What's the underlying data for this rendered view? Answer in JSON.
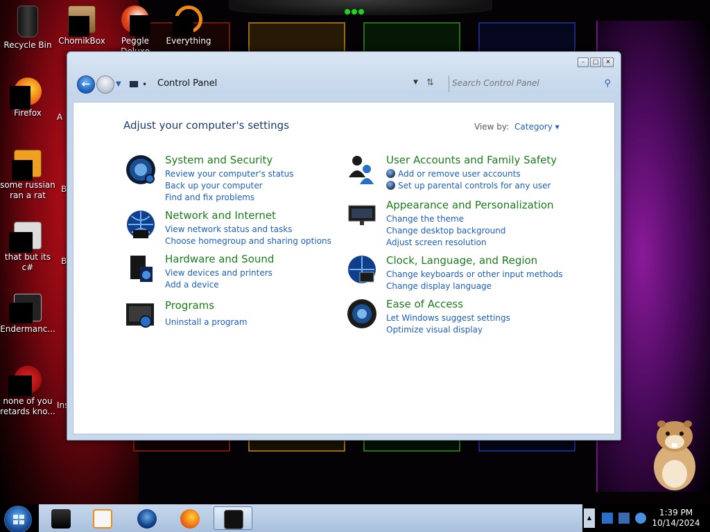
{
  "desktop": {
    "icons": [
      {
        "label": "Recycle Bin"
      },
      {
        "label": "ChomikBox"
      },
      {
        "label": "Peggle Deluxe"
      },
      {
        "label": "Everything"
      },
      {
        "label": "Firefox"
      },
      {
        "label": "some russian ran a rat"
      },
      {
        "label": "that but its c#"
      },
      {
        "label": "Endermanc..."
      },
      {
        "label": "none of you retards kno..."
      }
    ],
    "partial_labels": [
      "A",
      "B",
      "B",
      "Ins"
    ]
  },
  "window": {
    "address": {
      "location": "Control Panel"
    },
    "search": {
      "placeholder": "Search Control Panel"
    },
    "heading": "Adjust your computer's settings",
    "view_by": {
      "label": "View by:",
      "value": "Category"
    },
    "categories": [
      {
        "title": "System and Security",
        "links": [
          "Review your computer's status",
          "Back up your computer",
          "Find and fix problems"
        ]
      },
      {
        "title": "Network and Internet",
        "links": [
          "View network status and tasks",
          "Choose homegroup and sharing options"
        ]
      },
      {
        "title": "Hardware and Sound",
        "links": [
          "View devices and printers",
          "Add a device"
        ]
      },
      {
        "title": "Programs",
        "links": [
          "Uninstall a program"
        ]
      },
      {
        "title": "User Accounts and Family Safety",
        "links": [
          "Add or remove user accounts",
          "Set up parental controls for any user"
        ]
      },
      {
        "title": "Appearance and Personalization",
        "links": [
          "Change the theme",
          "Change desktop background",
          "Adjust screen resolution"
        ]
      },
      {
        "title": "Clock, Language, and Region",
        "links": [
          "Change keyboards or other input methods",
          "Change display language"
        ]
      },
      {
        "title": "Ease of Access",
        "links": [
          "Let Windows suggest settings",
          "Optimize visual display"
        ]
      }
    ]
  },
  "taskbar": {
    "pinned": [
      "terminal-app-icon",
      "media-player-icon",
      "globe-app-icon",
      "firefox-icon",
      "control-panel-icon"
    ],
    "clock": {
      "time": "1:39 PM",
      "date": "10/14/2024"
    }
  },
  "colors": {
    "category_green": "#1a7d1a",
    "link_blue": "#1a5fbf",
    "heading_blue": "#1c3b6b"
  }
}
